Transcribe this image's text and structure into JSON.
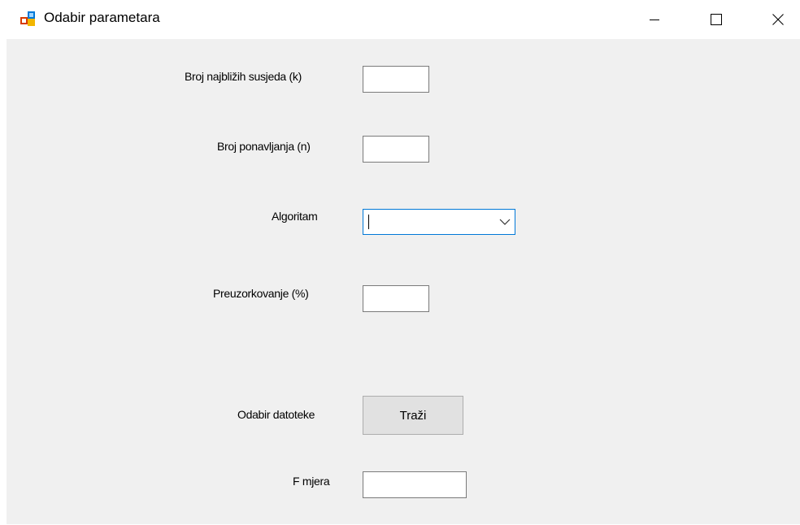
{
  "window": {
    "title": "Odabir parametara"
  },
  "titlebar": {
    "minimize_icon": "minimize-icon",
    "maximize_icon": "maximize-icon",
    "close_icon": "close-icon"
  },
  "form": {
    "k_label": "Broj najbližih susjeda (k)",
    "k_value": "",
    "n_label": "Broj ponavljanja (n)",
    "n_value": "",
    "algorithm_label": "Algoritam",
    "algorithm_value": "",
    "oversampling_label": "Preuzorkovanje (%)",
    "oversampling_value": "",
    "file_label": "Odabir datoteke",
    "browse_button": "Traži",
    "fmeasure_label": "F mjera",
    "fmeasure_value": ""
  },
  "colors": {
    "client_background": "#f0f0f0",
    "focus_border": "#0078d7",
    "button_background": "#e1e1e1"
  }
}
